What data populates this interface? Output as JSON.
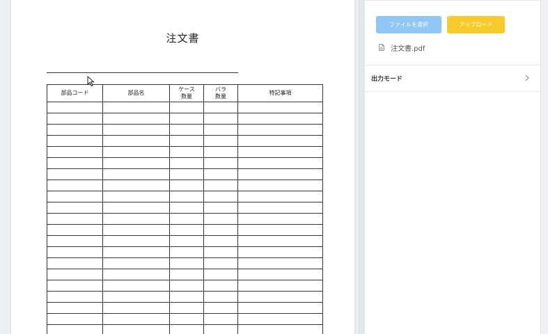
{
  "viewer": {
    "document": {
      "title": "注文書",
      "table": {
        "headers": [
          {
            "line1": "部品コード",
            "line2": ""
          },
          {
            "line1": "部品名",
            "line2": ""
          },
          {
            "line1": "ケース",
            "line2": "数量"
          },
          {
            "line1": "バラ",
            "line2": "数量"
          },
          {
            "line1": "特記事項",
            "line2": ""
          }
        ],
        "empty_rows": 22
      }
    }
  },
  "panel": {
    "select_file_label": "ファイルを選択",
    "upload_label": "アップロード",
    "file_name": "注文書.pdf",
    "output_mode_label": "出力モード",
    "colors": {
      "select_button": "#8fc6f3",
      "upload_button": "#f7cc29"
    }
  }
}
